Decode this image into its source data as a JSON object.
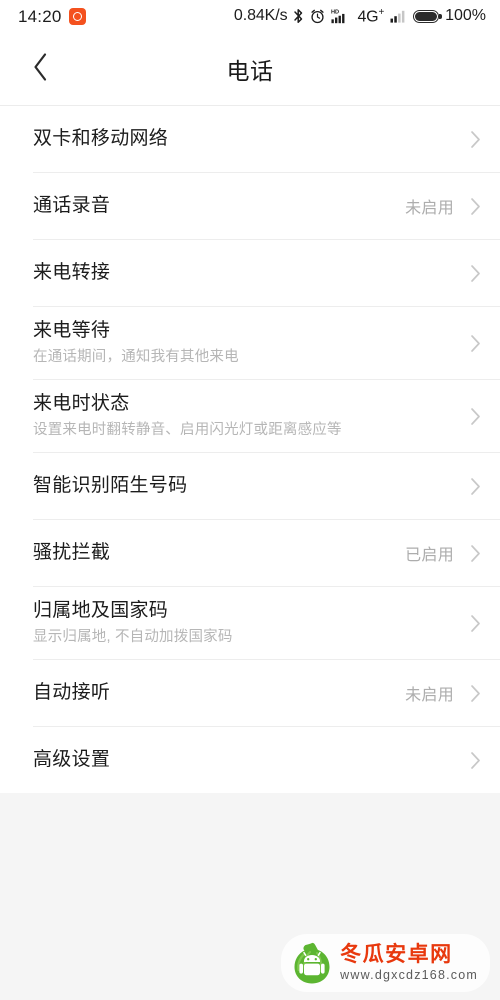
{
  "status_bar": {
    "clock": "14:20",
    "app_icon": "alarm-app-icon",
    "net_speed": "0.84K/s",
    "icons": [
      "bluetooth-icon",
      "alarm-icon",
      "hd-signal-icon",
      "signal-bars-icon"
    ],
    "network_type": "4G",
    "network_sup": "+",
    "battery_percent": "100%",
    "battery_level": 100
  },
  "app_bar": {
    "back_icon": "chevron-left-icon",
    "title": "电话"
  },
  "list": {
    "chevron_icon": "chevron-right-icon",
    "items": [
      {
        "title": "双卡和移动网络",
        "sub": "",
        "value": ""
      },
      {
        "title": "通话录音",
        "sub": "",
        "value": "未启用"
      },
      {
        "title": "来电转接",
        "sub": "",
        "value": ""
      },
      {
        "title": "来电等待",
        "sub": "在通话期间，通知我有其他来电",
        "value": ""
      },
      {
        "title": "来电时状态",
        "sub": "设置来电时翻转静音、启用闪光灯或距离感应等",
        "value": ""
      },
      {
        "title": "智能识别陌生号码",
        "sub": "",
        "value": ""
      },
      {
        "title": "骚扰拦截",
        "sub": "",
        "value": "已启用"
      },
      {
        "title": "归属地及国家码",
        "sub": "显示归属地, 不自动加拨国家码",
        "value": ""
      },
      {
        "title": "自动接听",
        "sub": "",
        "value": "未启用"
      },
      {
        "title": "高级设置",
        "sub": "",
        "value": ""
      }
    ]
  },
  "watermark": {
    "logo_icon": "winter-melon-android-logo",
    "site_name": "冬瓜安卓网",
    "site_url": "www.dgxcdz168.com"
  },
  "colors": {
    "page_bg": "#f5f5f5",
    "card_bg": "#ffffff",
    "title_text": "#1c1c1c",
    "sub_text": "#b6b6b6",
    "value_text": "#adadad",
    "divider": "#ededed",
    "accent_orange": "#f4511e",
    "logo_green": "#5cb531",
    "wm_red": "#e8380d"
  }
}
